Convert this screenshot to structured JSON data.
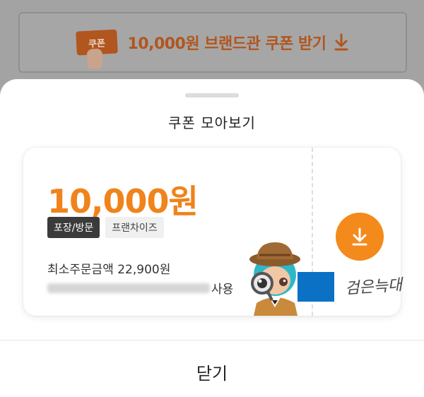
{
  "background": {
    "coupon_tag_label": "쿠폰",
    "banner_text": "10,000원 브랜드관 쿠폰 받기",
    "download_icon": "download-icon"
  },
  "sheet": {
    "title": "쿠폰 모아보기",
    "coupon": {
      "amount": "10,000원",
      "tags": [
        "포장/방문",
        "프랜차이즈"
      ],
      "min_order": "최소주문금액 22,900원",
      "period_suffix": "사용",
      "mascot": "detective-mascot"
    },
    "close_label": "닫기"
  },
  "watermark": {
    "signature": "검은늑대"
  },
  "colors": {
    "accent": "#f0831b",
    "button": "#f38a1b",
    "dim_overlay": "#a3a3a3",
    "tag_dark": "#3b3b3b",
    "brand_blue": "#0a71c5"
  }
}
